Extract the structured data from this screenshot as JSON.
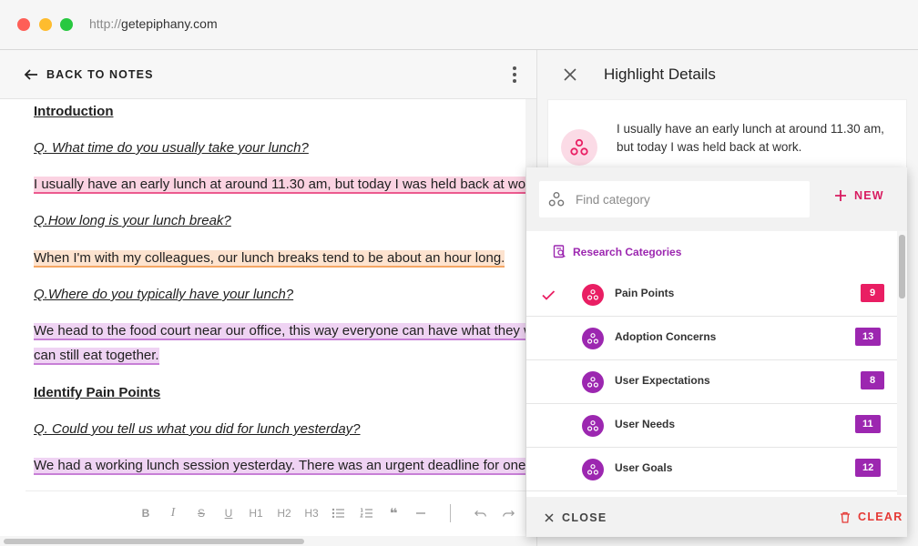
{
  "browser": {
    "url_protocol": "http://",
    "url_host": "getepiphany.com"
  },
  "notes": {
    "back_label": "BACK TO NOTES",
    "lines": [
      {
        "style": "heading",
        "text": "Introduction"
      },
      {
        "style": "question",
        "text": "Q. What time do you usually take your lunch?"
      },
      {
        "style": "highlight-pink",
        "text": "I usually have an early lunch at around 11.30 am, but today I was held back at work."
      },
      {
        "style": "question",
        "text": "Q.How long is your lunch break?"
      },
      {
        "style": "highlight-orange",
        "text": "When I'm with my colleagues, our lunch breaks tend to be about an hour long."
      },
      {
        "style": "question",
        "text": "Q.Where do you typically have your lunch?"
      },
      {
        "style": "highlight-purple",
        "text": "We head to the food court near our office, this way everyone can have what they want and we"
      },
      {
        "style": "highlight-purple",
        "text": "can still eat together."
      },
      {
        "style": "heading",
        "text": "Identify Pain Points"
      },
      {
        "style": "question",
        "text": "Q. Could you tell us what you did for lunch yesterday?"
      },
      {
        "style": "highlight-purple",
        "text": "We had a working lunch session yesterday. There was an urgent deadline for one of our projects."
      }
    ],
    "toolbar": {
      "bold": "B",
      "italic": "I",
      "strike": "S",
      "underline": "U",
      "h1": "H1",
      "h2": "H2",
      "h3": "H3",
      "quote": "❝"
    }
  },
  "details": {
    "title": "Highlight Details",
    "highlight_text": "I usually have an early lunch at around 11.30 am, but today I was held back at work."
  },
  "category_picker": {
    "search_placeholder": "Find category",
    "search_value": "",
    "new_label": "NEW",
    "section_label": "Research Categories",
    "categories": [
      {
        "name": "Pain Points",
        "count": "9",
        "selected": true,
        "color": "#e91e63"
      },
      {
        "name": "Adoption Concerns",
        "count": "13",
        "selected": false,
        "color": "#9c27b0"
      },
      {
        "name": "User Expectations",
        "count": "8",
        "selected": false,
        "color": "#9c27b0"
      },
      {
        "name": "User Needs",
        "count": "11",
        "selected": false,
        "color": "#9c27b0"
      },
      {
        "name": "User Goals",
        "count": "12",
        "selected": false,
        "color": "#9c27b0"
      }
    ],
    "close_label": "CLOSE",
    "clear_label": "CLEAR"
  },
  "colors": {
    "accent_pink": "#e91e63",
    "accent_purple": "#9c27b0",
    "danger": "#e53935"
  }
}
